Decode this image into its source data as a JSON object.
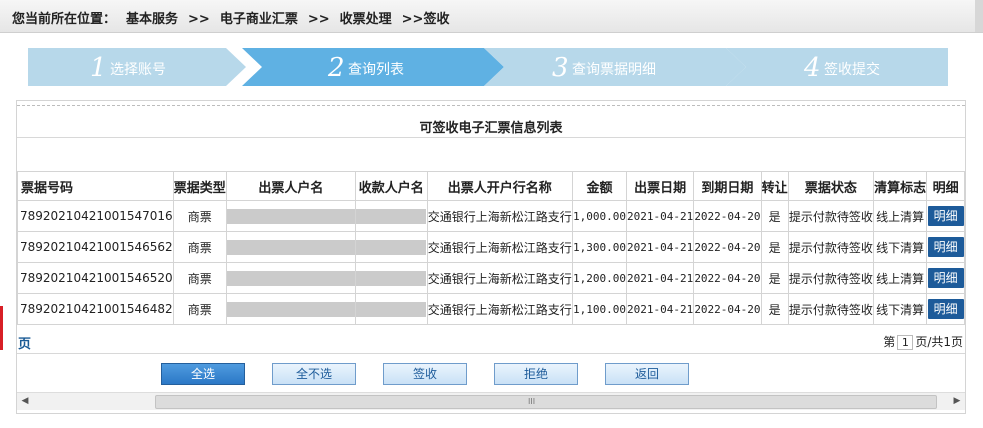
{
  "breadcrumb": {
    "prefix": "您当前所在位置：",
    "level1": "基本服务",
    "sep1": ">>",
    "level2": "电子商业汇票",
    "sep2": ">>",
    "level3": "收票处理",
    "level4": ">>签收"
  },
  "steps": [
    {
      "num": "1",
      "label": "选择账号",
      "active": false
    },
    {
      "num": "2",
      "label": "查询列表",
      "active": true
    },
    {
      "num": "3",
      "label": "查询票据明细",
      "active": false
    },
    {
      "num": "4",
      "label": "签收提交",
      "active": false
    }
  ],
  "table": {
    "title": "可签收电子汇票信息列表",
    "headers": [
      "票据号码",
      "票据类型",
      "出票人户名",
      "收款人户名",
      "出票人开户行名称",
      "金额",
      "出票日期",
      "到期日期",
      "转让",
      "票据状态",
      "清算标志",
      "明细"
    ],
    "rows": [
      {
        "bill_no": "78920210421001547016",
        "type": "商票",
        "bank": "交通银行上海新松江路支行",
        "amount": "1,000.00",
        "issue_date": "2021-04-21",
        "due_date": "2022-04-20",
        "transfer": "是",
        "status": "提示付款待签收",
        "clearing": "线上清算",
        "detail": "明细"
      },
      {
        "bill_no": "78920210421001546562",
        "type": "商票",
        "bank": "交通银行上海新松江路支行",
        "amount": "1,300.00",
        "issue_date": "2021-04-21",
        "due_date": "2022-04-20",
        "transfer": "是",
        "status": "提示付款待签收",
        "clearing": "线下清算",
        "detail": "明细"
      },
      {
        "bill_no": "78920210421001546520",
        "type": "商票",
        "bank": "交通银行上海新松江路支行",
        "amount": "1,200.00",
        "issue_date": "2021-04-21",
        "due_date": "2022-04-20",
        "transfer": "是",
        "status": "提示付款待签收",
        "clearing": "线上清算",
        "detail": "明细"
      },
      {
        "bill_no": "78920210421001546482",
        "type": "商票",
        "bank": "交通银行上海新松江路支行",
        "amount": "1,100.00",
        "issue_date": "2021-04-21",
        "due_date": "2022-04-20",
        "transfer": "是",
        "status": "提示付款待签收",
        "clearing": "线下清算",
        "detail": "明细"
      }
    ]
  },
  "pager": {
    "left_text": "页",
    "prefix": "第",
    "current": "1",
    "suffix": "页/共1页"
  },
  "actions": {
    "select_all": "全选",
    "select_none": "全不选",
    "sign": "签收",
    "reject": "拒绝",
    "back": "返回"
  },
  "scrollbar": {
    "left_arrow": "◀",
    "right_arrow": "▶",
    "grip": "III"
  },
  "colors": {
    "active_step": "#5fb1e3",
    "inactive_step": "#b7d8ea",
    "detail_button": "#1d5b9a"
  }
}
